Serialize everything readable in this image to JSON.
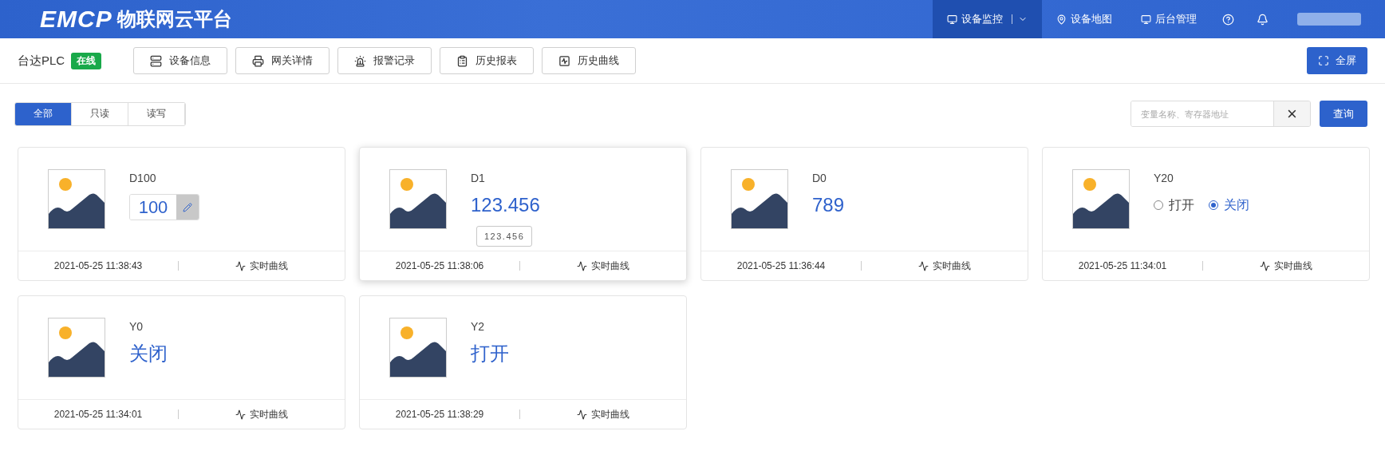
{
  "header": {
    "logo": "EMCP",
    "title": "物联网云平台",
    "nav": [
      {
        "label": "设备监控",
        "selected": true,
        "kind": "dropdown"
      },
      {
        "label": "设备地图",
        "selected": false,
        "kind": "map"
      },
      {
        "label": "后台管理",
        "selected": false,
        "kind": "admin"
      }
    ]
  },
  "device": {
    "name": "台达PLC",
    "status": "在线",
    "buttons": [
      {
        "label": "设备信息",
        "kind": "info"
      },
      {
        "label": "网关详情",
        "kind": "gateway"
      },
      {
        "label": "报警记录",
        "kind": "alarm"
      },
      {
        "label": "历史报表",
        "kind": "report"
      },
      {
        "label": "历史曲线",
        "kind": "curve"
      }
    ],
    "fullscreen": "全屏"
  },
  "filter": {
    "tabs": [
      {
        "label": "全部",
        "selected": true
      },
      {
        "label": "只读",
        "selected": false
      },
      {
        "label": "读写",
        "selected": false
      }
    ],
    "search": {
      "placeholder": "变量名称、寄存器地址"
    },
    "clear": "×",
    "query": "查询"
  },
  "cards": [
    {
      "name": "D100",
      "kind": "input",
      "value": "100",
      "time": "2021-05-25 11:38:43",
      "link": "实时曲线",
      "hovered": false
    },
    {
      "name": "D1",
      "kind": "value",
      "value": "123.456",
      "tooltip": "123.456",
      "time": "2021-05-25 11:38:06",
      "link": "实时曲线",
      "hovered": true
    },
    {
      "name": "D0",
      "kind": "value",
      "value": "789",
      "time": "2021-05-25 11:36:44",
      "link": "实时曲线",
      "hovered": false
    },
    {
      "name": "Y20",
      "kind": "radio",
      "options": [
        {
          "label": "打开",
          "selected": false
        },
        {
          "label": "关闭",
          "selected": true
        }
      ],
      "time": "2021-05-25 11:34:01",
      "link": "实时曲线",
      "hovered": false
    },
    {
      "name": "Y0",
      "kind": "value",
      "value": "关闭",
      "time": "2021-05-25 11:34:01",
      "link": "实时曲线",
      "hovered": false
    },
    {
      "name": "Y2",
      "kind": "value",
      "value": "打开",
      "time": "2021-05-25 11:38:29",
      "link": "实时曲线",
      "hovered": false
    }
  ]
}
